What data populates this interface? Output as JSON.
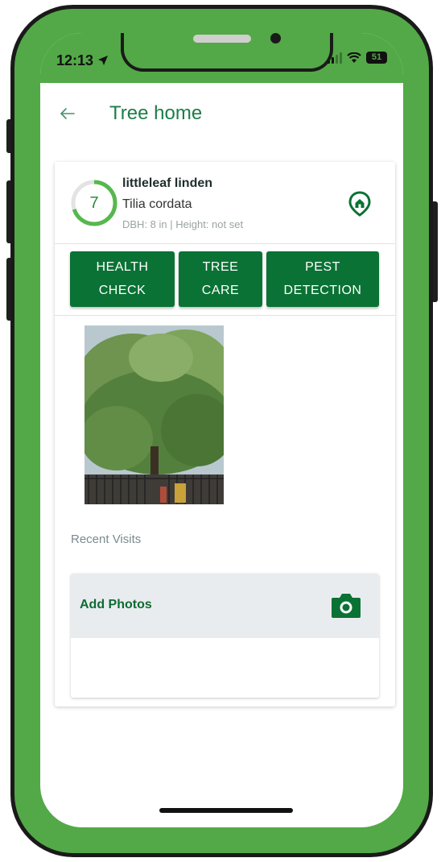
{
  "status_bar": {
    "time": "12:13",
    "battery": "51"
  },
  "header": {
    "title": "Tree home"
  },
  "tree": {
    "common_name": "littleleaf linden",
    "scientific_name": "Tilia cordata",
    "measurements": "DBH: 8 in | Height: not set",
    "score": "7",
    "score_fraction": 0.7
  },
  "actions": [
    {
      "line1": "HEALTH",
      "line2": "CHECK"
    },
    {
      "line1": "TREE",
      "line2": "CARE"
    },
    {
      "line1": "PEST",
      "line2": "DETECTION"
    }
  ],
  "recent_visits": {
    "label": "Recent Visits"
  },
  "add_photos": {
    "label": "Add Photos"
  },
  "icons": {
    "back": "arrow-left-icon",
    "location": "location-pin-icon",
    "camera": "camera-icon"
  },
  "colors": {
    "brand_green": "#53a947",
    "button_green": "#0a7234",
    "title_green": "#1d7d48"
  }
}
